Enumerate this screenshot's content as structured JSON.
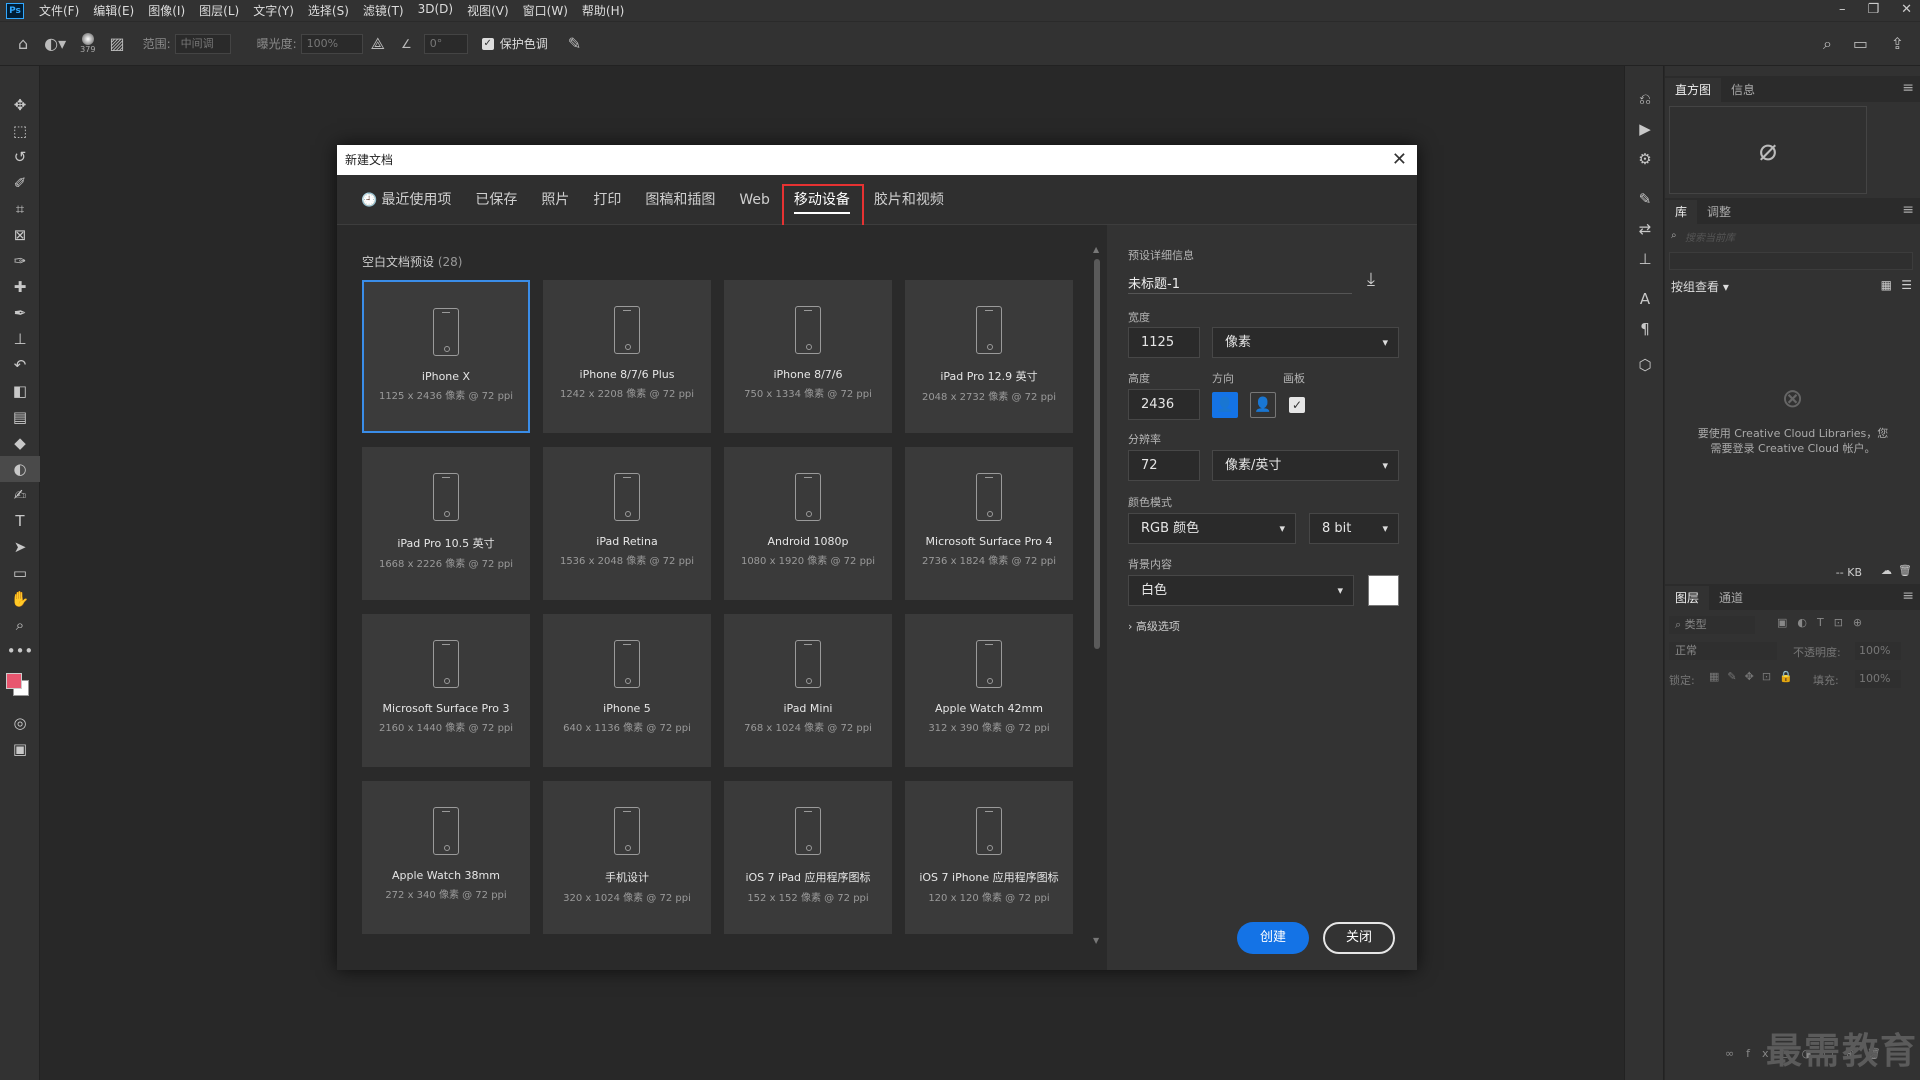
{
  "menubar": {
    "logo": "Ps",
    "items": [
      "文件(F)",
      "编辑(E)",
      "图像(I)",
      "图层(L)",
      "文字(Y)",
      "选择(S)",
      "滤镜(T)",
      "3D(D)",
      "视图(V)",
      "窗口(W)",
      "帮助(H)"
    ],
    "window_controls": [
      "–",
      "❐",
      "✕"
    ]
  },
  "options": {
    "brush_size": "379",
    "range_label": "范围:",
    "range_value": "中间调",
    "exposure_label": "曝光度:",
    "exposure_value": "100%",
    "angle_value": "0°",
    "protect_tone_label": "保护色调"
  },
  "right_panel": {
    "top_tabs": [
      "直方图",
      "信息"
    ],
    "lib_tabs": [
      "库",
      "调整"
    ],
    "lib_search_placeholder": "搜索当前库",
    "lib_view": "按组查看",
    "lib_message": "要使用 Creative Cloud Libraries，您需要登录 Creative Cloud 帐户。",
    "lib_size": "-- KB",
    "layer_tabs": [
      "图层",
      "通道"
    ],
    "layer_filter": "类型",
    "blend_mode": "正常",
    "opacity_label": "不透明度:",
    "opacity_value": "100%",
    "lock_label": "锁定:",
    "fill_label": "填充:",
    "fill_value": "100%"
  },
  "dialog": {
    "title": "新建文档",
    "tabs": [
      "最近使用项",
      "已保存",
      "照片",
      "打印",
      "图稿和插图",
      "Web",
      "移动设备",
      "胶片和视频"
    ],
    "active_tab": "移动设备",
    "preset_header": "空白文档预设",
    "preset_count": "(28)",
    "presets": [
      {
        "name": "iPhone X",
        "dims": "1125 x 2436 像素 @ 72 ppi"
      },
      {
        "name": "iPhone 8/7/6 Plus",
        "dims": "1242 x 2208 像素 @ 72 ppi"
      },
      {
        "name": "iPhone 8/7/6",
        "dims": "750 x 1334 像素 @ 72 ppi"
      },
      {
        "name": "iPad Pro 12.9 英寸",
        "dims": "2048 x 2732 像素 @ 72 ppi"
      },
      {
        "name": "iPad Pro 10.5 英寸",
        "dims": "1668 x 2226 像素 @ 72 ppi"
      },
      {
        "name": "iPad Retina",
        "dims": "1536 x 2048 像素 @ 72 ppi"
      },
      {
        "name": "Android 1080p",
        "dims": "1080 x 1920 像素 @ 72 ppi"
      },
      {
        "name": "Microsoft Surface Pro 4",
        "dims": "2736 x 1824 像素 @ 72 ppi"
      },
      {
        "name": "Microsoft Surface Pro 3",
        "dims": "2160 x 1440 像素 @ 72 ppi"
      },
      {
        "name": "iPhone 5",
        "dims": "640 x 1136 像素 @ 72 ppi"
      },
      {
        "name": "iPad Mini",
        "dims": "768 x 1024 像素 @ 72 ppi"
      },
      {
        "name": "Apple Watch 42mm",
        "dims": "312 x 390 像素 @ 72 ppi"
      },
      {
        "name": "Apple Watch 38mm",
        "dims": "272 x 340 像素 @ 72 ppi"
      },
      {
        "name": "手机设计",
        "dims": "320 x 1024 像素 @ 72 ppi"
      },
      {
        "name": "iOS 7 iPad 应用程序图标",
        "dims": "152 x 152 像素 @ 72 ppi"
      },
      {
        "name": "iOS 7 iPhone 应用程序图标",
        "dims": "120 x 120 像素 @ 72 ppi"
      }
    ],
    "details": {
      "header": "预设详细信息",
      "doc_name": "未标题-1",
      "width_label": "宽度",
      "width_value": "1125",
      "width_unit": "像素",
      "height_label": "高度",
      "height_value": "2436",
      "orientation_label": "方向",
      "artboard_label": "画板",
      "resolution_label": "分辨率",
      "resolution_value": "72",
      "resolution_unit": "像素/英寸",
      "color_mode_label": "颜色模式",
      "color_mode": "RGB 颜色",
      "bit_depth": "8 bit",
      "background_label": "背景内容",
      "background_value": "白色",
      "advanced_label": "高级选项",
      "create_label": "创建",
      "close_label": "关闭"
    }
  },
  "watermark": "最需教育",
  "colors": {
    "accent": "#1473e6",
    "highlight": "#e63232",
    "fg_swatch": "#e8566f",
    "bg_swatch": "#ffffff"
  }
}
